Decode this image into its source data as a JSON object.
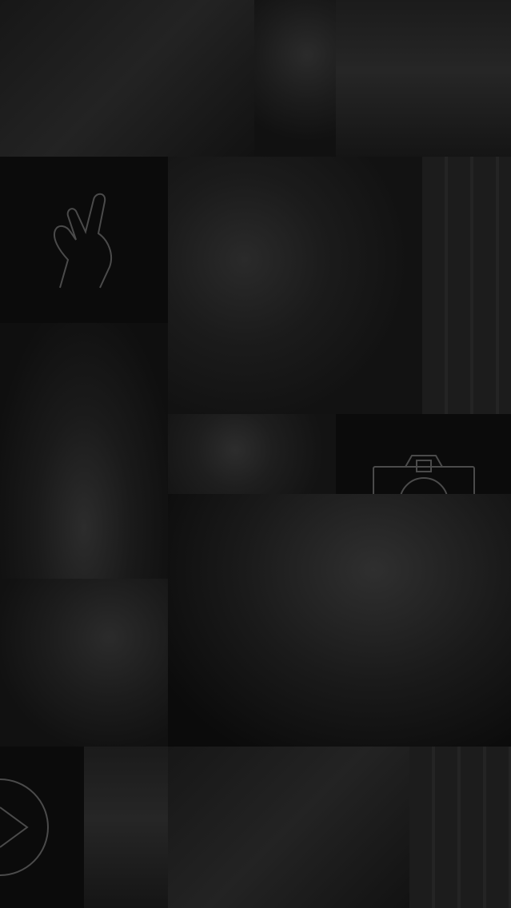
{
  "icons": {
    "hand": "peace-hand-icon",
    "camera": "camera-icon",
    "play": "play-icon"
  },
  "colors": {
    "background": "#000000",
    "icon_stroke": "#4b4b4b"
  }
}
